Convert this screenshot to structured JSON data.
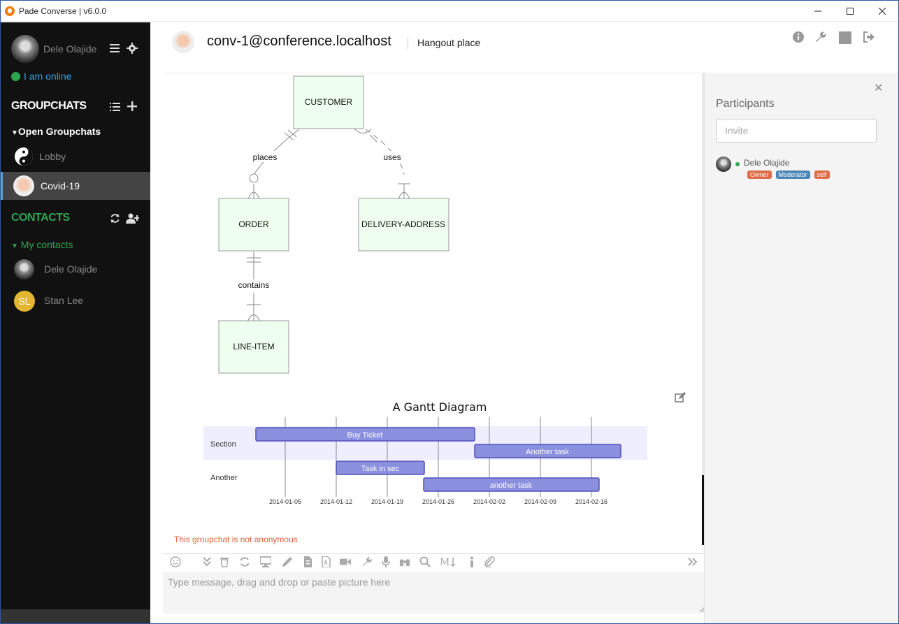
{
  "window": {
    "title": "Pade Converse | v6.0.0"
  },
  "sidebar": {
    "user_name": "Dele Olajide",
    "status_text": "I am online",
    "groupchats_heading": "GROUPCHATS",
    "open_groupchats_label": "Open Groupchats",
    "rooms": [
      {
        "label": "Lobby",
        "active": false
      },
      {
        "label": "Covid-19",
        "active": true
      }
    ],
    "contacts_heading": "CONTACTS",
    "my_contacts_label": "My contacts",
    "contacts": [
      {
        "name": "Dele Olajide",
        "initials": ""
      },
      {
        "name": "Stan Lee",
        "initials": "SL"
      }
    ],
    "colors": {
      "online": "#2ea44f",
      "accent_green": "#2ea44f",
      "initials_bg": "#e2b62f"
    }
  },
  "header": {
    "room_jid": "conv-1@conference.localhost",
    "topic": "Hangout place",
    "icons": [
      "info-icon",
      "wrench-icon",
      "stop-icon",
      "exit-icon"
    ]
  },
  "er_diagram": {
    "entities": [
      "CUSTOMER",
      "ORDER",
      "DELIVERY-ADDRESS",
      "LINE-ITEM"
    ],
    "relations": [
      "places",
      "uses",
      "contains"
    ]
  },
  "gantt": {
    "title": "A Gantt Diagram",
    "sections": [
      "Section",
      "Another"
    ],
    "tasks": [
      "Buy Ticket",
      "Another task",
      "Task in sec",
      "another task"
    ],
    "axis_dates": [
      "2014-01-05",
      "2014-01-12",
      "2014-01-19",
      "2014-01-26",
      "2014-02-02",
      "2014-02-09",
      "2014-02-16"
    ]
  },
  "chat": {
    "notice": "This groupchat is not anonymous",
    "compose_placeholder": "Type message, drag and drop or paste picture here"
  },
  "participants": {
    "title": "Participants",
    "invite_placeholder": "Invite",
    "members": [
      {
        "name": "Dele Olajide",
        "badges": [
          "Owner",
          "Moderator",
          "self"
        ]
      }
    ],
    "badge_colors": {
      "Owner": "#e06b48",
      "Moderator": "#4b86b4",
      "self": "#e06b48"
    }
  }
}
